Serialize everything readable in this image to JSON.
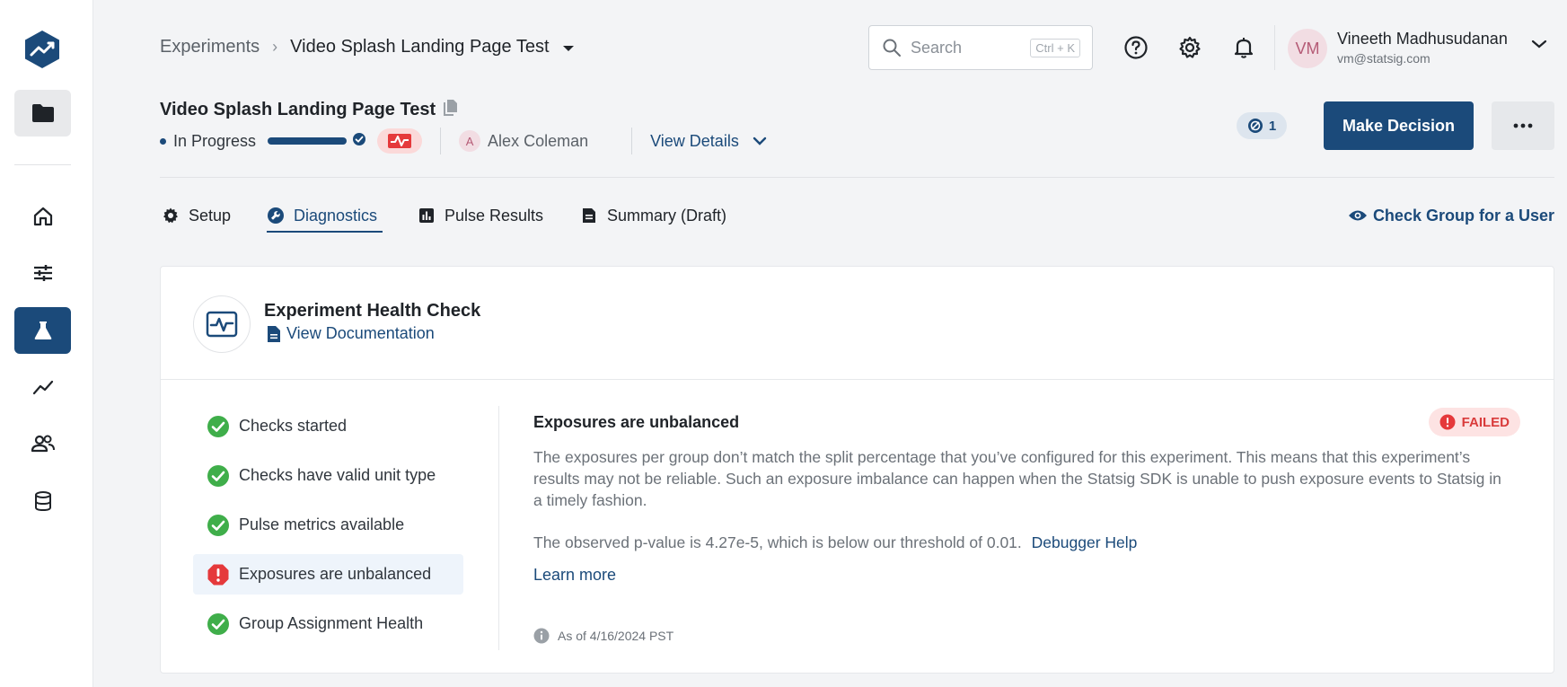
{
  "breadcrumb": {
    "root": "Experiments",
    "current": "Video Splash Landing Page Test"
  },
  "search": {
    "placeholder": "Search",
    "shortcut": "Ctrl + K"
  },
  "user": {
    "initials": "VM",
    "name": "Vineeth Madhusudanan",
    "email": "vm@statsig.com"
  },
  "experiment": {
    "title": "Video Splash Landing Page Test",
    "status": "In Progress",
    "progress_fraction": 1.0,
    "owner_initial": "A",
    "owner_name": "Alex Coleman",
    "view_details": "View Details",
    "alert_count": "1",
    "make_decision": "Make Decision"
  },
  "tabs": [
    {
      "label": "Setup",
      "icon": "gear-icon"
    },
    {
      "label": "Diagnostics",
      "icon": "wrench-icon",
      "active": true
    },
    {
      "label": "Pulse Results",
      "icon": "bar-chart-icon"
    },
    {
      "label": "Summary (Draft)",
      "icon": "document-icon"
    }
  ],
  "check_group": "Check Group for a User",
  "health": {
    "title": "Experiment Health Check",
    "doc_link": "View Documentation",
    "checks": [
      {
        "label": "Checks started",
        "status": "pass"
      },
      {
        "label": "Checks have valid unit type",
        "status": "pass"
      },
      {
        "label": "Pulse metrics available",
        "status": "pass"
      },
      {
        "label": "Exposures are unbalanced",
        "status": "fail"
      },
      {
        "label": "Group Assignment Health",
        "status": "pass"
      }
    ],
    "detail": {
      "title": "Exposures are unbalanced",
      "badge": "FAILED",
      "body": "The exposures per group don’t match the split percentage that you’ve configured for this experiment. This means that this experiment’s results may not be reliable. Such an exposure imbalance can happen when the Statsig SDK is unable to push exposure events to Statsig in a timely fashion.",
      "pvalue": "The observed p-value is 4.27e-5, which is below our threshold of 0.01.",
      "debugger_help": "Debugger Help",
      "learn_more": "Learn more",
      "as_of": "As of 4/16/2024 PST"
    }
  },
  "colors": {
    "brand": "#1b4a7a",
    "pass": "#3fae4a",
    "fail": "#e5393b"
  }
}
